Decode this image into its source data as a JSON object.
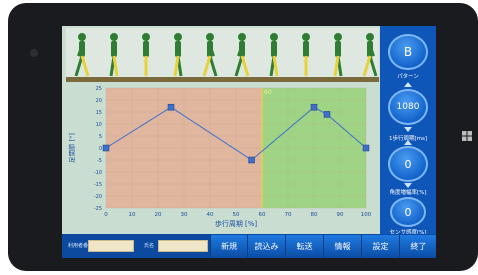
{
  "sidebar": {
    "pattern_value": "B",
    "pattern_label": "パターン",
    "period_value": "1080",
    "period_label": "1歩行周期[ms]",
    "gain_value": "0",
    "gain_label": "角度増幅率[%]",
    "sensor_value": "0",
    "sensor_label": "センサ感度[%]"
  },
  "chart_data": {
    "type": "line",
    "xlabel": "歩行周期 [%]",
    "ylabel": "足関節 [°]",
    "xlim": [
      0,
      100
    ],
    "ylim": [
      -25,
      25
    ],
    "x_ticks": [
      "0",
      "10",
      "20",
      "30",
      "40",
      "50",
      "60",
      "70",
      "80",
      "90",
      "100"
    ],
    "y_ticks": [
      "25",
      "20",
      "15",
      "10",
      "5",
      "0",
      "-5",
      "-10",
      "-15",
      "-20",
      "-25"
    ],
    "x": [
      0,
      25,
      56,
      80,
      85,
      100
    ],
    "y": [
      0,
      17,
      -5,
      17,
      14,
      0
    ],
    "marker_label": "60",
    "marker_x": 60,
    "regions": [
      {
        "from": 0,
        "to": 60,
        "color": "#e8a88e"
      },
      {
        "from": 60,
        "to": 100,
        "color": "#8fd06a"
      }
    ],
    "line_color": "#3b6fd0",
    "marker_line_color": "#e6d34a"
  },
  "bottom": {
    "field1_label": "利用者番号",
    "field2_label": "氏名",
    "buttons": [
      "新規",
      "読込み",
      "転送",
      "情報",
      "設定",
      "終了"
    ]
  }
}
